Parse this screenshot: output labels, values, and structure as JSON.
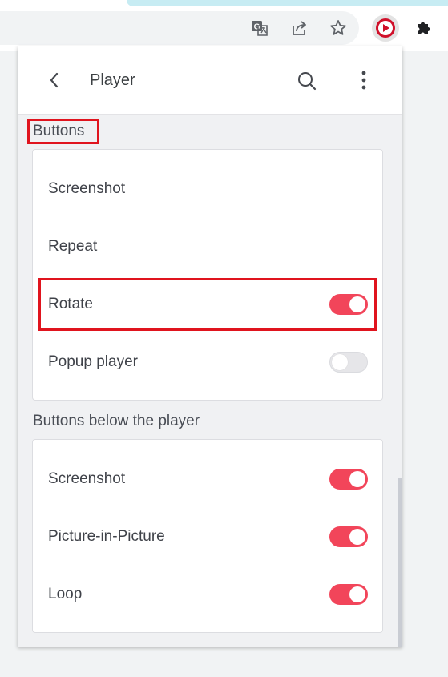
{
  "toolbar": {
    "icons": [
      "translate-icon",
      "share-icon",
      "bookmark-star-icon",
      "extension-player-icon",
      "puzzle-icon"
    ]
  },
  "header": {
    "title": "Player",
    "back_icon": "chevron-left-icon",
    "search_icon": "search-icon",
    "more_icon": "more-vert-icon"
  },
  "sections": {
    "buttons": {
      "label": "Buttons",
      "items": [
        {
          "label": "Screenshot"
        },
        {
          "label": "Repeat"
        },
        {
          "label": "Rotate",
          "toggle": true
        },
        {
          "label": "Popup player",
          "toggle": false
        }
      ]
    },
    "below": {
      "label": "Buttons below the player",
      "items": [
        {
          "label": "Screenshot",
          "toggle": true
        },
        {
          "label": "Picture-in-Picture",
          "toggle": true
        },
        {
          "label": "Loop",
          "toggle": true
        }
      ]
    }
  },
  "colors": {
    "accent": "#f2455a",
    "highlight": "#e0141e",
    "extension_red": "#d0102a"
  }
}
